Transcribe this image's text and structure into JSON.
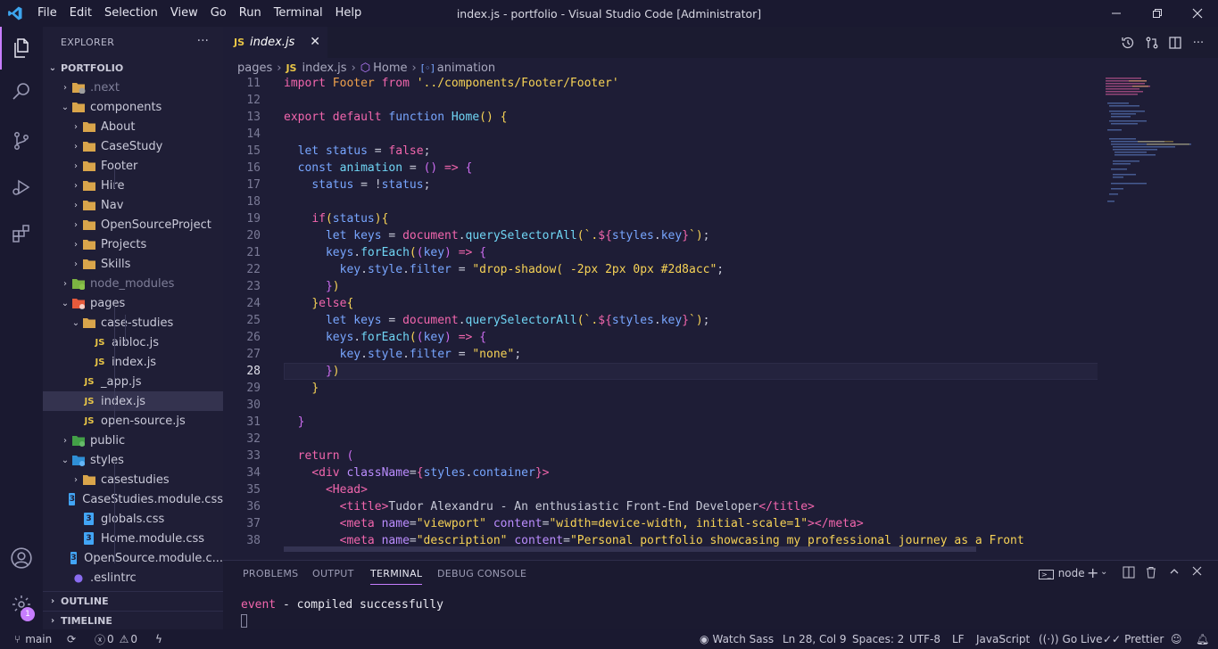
{
  "titlebar": {
    "menus": [
      "File",
      "Edit",
      "Selection",
      "View",
      "Go",
      "Run",
      "Terminal",
      "Help"
    ],
    "title": "index.js - portfolio - Visual Studio Code [Administrator]"
  },
  "activity": {
    "badge": "1"
  },
  "sidebar": {
    "header": "EXPLORER",
    "root": "PORTFOLIO",
    "items": [
      {
        "label": ".next",
        "kind": "folder-special",
        "depth": 1,
        "open": false,
        "dim": true
      },
      {
        "label": "components",
        "kind": "folder",
        "depth": 1,
        "open": true
      },
      {
        "label": "About",
        "kind": "folder",
        "depth": 2,
        "open": false
      },
      {
        "label": "CaseStudy",
        "kind": "folder",
        "depth": 2,
        "open": false
      },
      {
        "label": "Footer",
        "kind": "folder",
        "depth": 2,
        "open": false
      },
      {
        "label": "Hire",
        "kind": "folder",
        "depth": 2,
        "open": false
      },
      {
        "label": "Nav",
        "kind": "folder",
        "depth": 2,
        "open": false
      },
      {
        "label": "OpenSourceProject",
        "kind": "folder",
        "depth": 2,
        "open": false
      },
      {
        "label": "Projects",
        "kind": "folder",
        "depth": 2,
        "open": false
      },
      {
        "label": "Skills",
        "kind": "folder",
        "depth": 2,
        "open": false
      },
      {
        "label": "node_modules",
        "kind": "folder-node",
        "depth": 1,
        "open": false,
        "dim": true
      },
      {
        "label": "pages",
        "kind": "folder-pages",
        "depth": 1,
        "open": true
      },
      {
        "label": "case-studies",
        "kind": "folder",
        "depth": 2,
        "open": true
      },
      {
        "label": "aibloc.js",
        "kind": "js",
        "depth": 3
      },
      {
        "label": "index.js",
        "kind": "js",
        "depth": 3
      },
      {
        "label": "_app.js",
        "kind": "js",
        "depth": 2
      },
      {
        "label": "index.js",
        "kind": "js",
        "depth": 2,
        "selected": true
      },
      {
        "label": "open-source.js",
        "kind": "js",
        "depth": 2
      },
      {
        "label": "public",
        "kind": "folder-public",
        "depth": 1,
        "open": false
      },
      {
        "label": "styles",
        "kind": "folder-styles",
        "depth": 1,
        "open": true
      },
      {
        "label": "casestudies",
        "kind": "folder",
        "depth": 2,
        "open": false
      },
      {
        "label": "CaseStudies.module.css",
        "kind": "css",
        "depth": 2
      },
      {
        "label": "globals.css",
        "kind": "css",
        "depth": 2
      },
      {
        "label": "Home.module.css",
        "kind": "css",
        "depth": 2
      },
      {
        "label": "OpenSource.module.c...",
        "kind": "css",
        "depth": 2
      },
      {
        "label": ".eslintrc",
        "kind": "eslint",
        "depth": 1
      }
    ],
    "outline": "OUTLINE",
    "timeline": "TIMELINE"
  },
  "editor": {
    "tab": "index.js",
    "breadcrumb": [
      "pages",
      "index.js",
      "Home",
      "animation"
    ],
    "lines": [
      {
        "n": "11",
        "tokens": [
          [
            "k",
            "import "
          ],
          [
            "pr",
            "Footer "
          ],
          [
            "k",
            "from "
          ],
          [
            "s",
            "'../components/Footer/Footer'"
          ]
        ]
      },
      {
        "n": "12",
        "tokens": []
      },
      {
        "n": "13",
        "tokens": [
          [
            "k",
            "export default "
          ],
          [
            "v",
            "function "
          ],
          [
            "f",
            "Home"
          ],
          [
            "c",
            "() {"
          ]
        ]
      },
      {
        "n": "14",
        "tokens": []
      },
      {
        "n": "15",
        "tokens": [
          [
            "p",
            "  "
          ],
          [
            "v",
            "let "
          ],
          [
            "v",
            "status "
          ],
          [
            "p",
            "= "
          ],
          [
            "k",
            "false"
          ],
          [
            "p",
            ";"
          ]
        ]
      },
      {
        "n": "16",
        "tokens": [
          [
            "p",
            "  "
          ],
          [
            "v",
            "const "
          ],
          [
            "f",
            "animation "
          ],
          [
            "p",
            "= "
          ],
          [
            "b",
            "() "
          ],
          [
            "k",
            "=> "
          ],
          [
            "b",
            "{"
          ]
        ]
      },
      {
        "n": "17",
        "tokens": [
          [
            "p",
            "    "
          ],
          [
            "v",
            "status "
          ],
          [
            "p",
            "= !"
          ],
          [
            "v",
            "status"
          ],
          [
            "p",
            ";"
          ]
        ]
      },
      {
        "n": "18",
        "tokens": []
      },
      {
        "n": "19",
        "tokens": [
          [
            "p",
            "    "
          ],
          [
            "k",
            "if"
          ],
          [
            "c",
            "("
          ],
          [
            "v",
            "status"
          ],
          [
            "c",
            "){"
          ]
        ]
      },
      {
        "n": "20",
        "tokens": [
          [
            "p",
            "      "
          ],
          [
            "v",
            "let "
          ],
          [
            "v",
            "keys "
          ],
          [
            "p",
            "= "
          ],
          [
            "k",
            "document"
          ],
          [
            "p",
            "."
          ],
          [
            "f",
            "querySelectorAll"
          ],
          [
            "c",
            "("
          ],
          [
            "s",
            "`."
          ],
          [
            "k",
            "${"
          ],
          [
            "v",
            "styles"
          ],
          [
            "p",
            "."
          ],
          [
            "v",
            "key"
          ],
          [
            "k",
            "}"
          ],
          [
            "s",
            "`"
          ],
          [
            "c",
            ")"
          ],
          [
            "p",
            ";"
          ]
        ]
      },
      {
        "n": "21",
        "tokens": [
          [
            "p",
            "      "
          ],
          [
            "v",
            "keys"
          ],
          [
            "p",
            "."
          ],
          [
            "f",
            "forEach"
          ],
          [
            "c",
            "("
          ],
          [
            "b",
            "("
          ],
          [
            "v",
            "key"
          ],
          [
            "b",
            ") "
          ],
          [
            "k",
            "=> "
          ],
          [
            "b",
            "{"
          ]
        ]
      },
      {
        "n": "22",
        "tokens": [
          [
            "p",
            "        "
          ],
          [
            "v",
            "key"
          ],
          [
            "p",
            "."
          ],
          [
            "v",
            "style"
          ],
          [
            "p",
            "."
          ],
          [
            "v",
            "filter "
          ],
          [
            "p",
            "= "
          ],
          [
            "s",
            "\"drop-shadow( -2px 2px 0px #2d8acc\""
          ],
          [
            "p",
            ";"
          ]
        ]
      },
      {
        "n": "23",
        "tokens": [
          [
            "p",
            "      "
          ],
          [
            "b",
            "}"
          ],
          [
            "c",
            ")"
          ]
        ]
      },
      {
        "n": "24",
        "tokens": [
          [
            "p",
            "    "
          ],
          [
            "c",
            "}"
          ],
          [
            "k",
            "else"
          ],
          [
            "c",
            "{"
          ]
        ]
      },
      {
        "n": "25",
        "tokens": [
          [
            "p",
            "      "
          ],
          [
            "v",
            "let "
          ],
          [
            "v",
            "keys "
          ],
          [
            "p",
            "= "
          ],
          [
            "k",
            "document"
          ],
          [
            "p",
            "."
          ],
          [
            "f",
            "querySelectorAll"
          ],
          [
            "c",
            "("
          ],
          [
            "s",
            "`."
          ],
          [
            "k",
            "${"
          ],
          [
            "v",
            "styles"
          ],
          [
            "p",
            "."
          ],
          [
            "v",
            "key"
          ],
          [
            "k",
            "}"
          ],
          [
            "s",
            "`"
          ],
          [
            "c",
            ")"
          ],
          [
            "p",
            ";"
          ]
        ]
      },
      {
        "n": "26",
        "tokens": [
          [
            "p",
            "      "
          ],
          [
            "v",
            "keys"
          ],
          [
            "p",
            "."
          ],
          [
            "f",
            "forEach"
          ],
          [
            "c",
            "("
          ],
          [
            "b",
            "("
          ],
          [
            "v",
            "key"
          ],
          [
            "b",
            ") "
          ],
          [
            "k",
            "=> "
          ],
          [
            "b",
            "{"
          ]
        ]
      },
      {
        "n": "27",
        "tokens": [
          [
            "p",
            "        "
          ],
          [
            "v",
            "key"
          ],
          [
            "p",
            "."
          ],
          [
            "v",
            "style"
          ],
          [
            "p",
            "."
          ],
          [
            "v",
            "filter "
          ],
          [
            "p",
            "= "
          ],
          [
            "s",
            "\"none\""
          ],
          [
            "p",
            ";"
          ]
        ]
      },
      {
        "n": "28",
        "tokens": [
          [
            "p",
            "      "
          ],
          [
            "b",
            "}"
          ],
          [
            "c",
            ")"
          ]
        ],
        "current": true
      },
      {
        "n": "29",
        "tokens": [
          [
            "p",
            "    "
          ],
          [
            "c",
            "}"
          ]
        ]
      },
      {
        "n": "30",
        "tokens": []
      },
      {
        "n": "31",
        "tokens": [
          [
            "p",
            "  "
          ],
          [
            "b",
            "}"
          ]
        ]
      },
      {
        "n": "32",
        "tokens": []
      },
      {
        "n": "33",
        "tokens": [
          [
            "p",
            "  "
          ],
          [
            "k",
            "return "
          ],
          [
            "b",
            "("
          ]
        ]
      },
      {
        "n": "34",
        "tokens": [
          [
            "p",
            "    "
          ],
          [
            "tg",
            "<div "
          ],
          [
            "at",
            "className"
          ],
          [
            "p",
            "="
          ],
          [
            "k",
            "{"
          ],
          [
            "v",
            "styles"
          ],
          [
            "p",
            "."
          ],
          [
            "v",
            "container"
          ],
          [
            "k",
            "}"
          ],
          [
            "tg",
            ">"
          ]
        ]
      },
      {
        "n": "35",
        "tokens": [
          [
            "p",
            "      "
          ],
          [
            "tg",
            "<Head>"
          ]
        ]
      },
      {
        "n": "36",
        "tokens": [
          [
            "p",
            "        "
          ],
          [
            "tg",
            "<title>"
          ],
          [
            "p",
            "Tudor Alexandru - An enthusiastic Front-End Developer"
          ],
          [
            "tg",
            "</title>"
          ]
        ]
      },
      {
        "n": "37",
        "tokens": [
          [
            "p",
            "        "
          ],
          [
            "tg",
            "<meta "
          ],
          [
            "at",
            "name"
          ],
          [
            "p",
            "="
          ],
          [
            "s",
            "\"viewport\" "
          ],
          [
            "at",
            "content"
          ],
          [
            "p",
            "="
          ],
          [
            "s",
            "\"width=device-width, initial-scale=1\""
          ],
          [
            "tg",
            "></meta>"
          ]
        ]
      },
      {
        "n": "38",
        "tokens": [
          [
            "p",
            "        "
          ],
          [
            "tg",
            "<meta "
          ],
          [
            "at",
            "name"
          ],
          [
            "p",
            "="
          ],
          [
            "s",
            "\"description\" "
          ],
          [
            "at",
            "content"
          ],
          [
            "p",
            "="
          ],
          [
            "s",
            "\"Personal portfolio showcasing my professional journey as a Front"
          ]
        ]
      }
    ]
  },
  "panel": {
    "tabs": [
      "PROBLEMS",
      "OUTPUT",
      "TERMINAL",
      "DEBUG CONSOLE"
    ],
    "active": "TERMINAL",
    "shell": "node",
    "terminal_event": "event",
    "terminal_msg": " - compiled successfully"
  },
  "status": {
    "branch": "main",
    "errors": "0",
    "warnings": "0",
    "watch": "Watch Sass",
    "pos": "Ln 28, Col 9",
    "spaces": "Spaces: 2",
    "encoding": "UTF-8",
    "eol": "LF",
    "lang": "JavaScript",
    "live": "Go Live",
    "prettier": "Prettier"
  },
  "colors": {
    "accent": "#c77dff",
    "bg": "#1e1d36",
    "js": "#e8c547",
    "css": "#42a5f5"
  }
}
